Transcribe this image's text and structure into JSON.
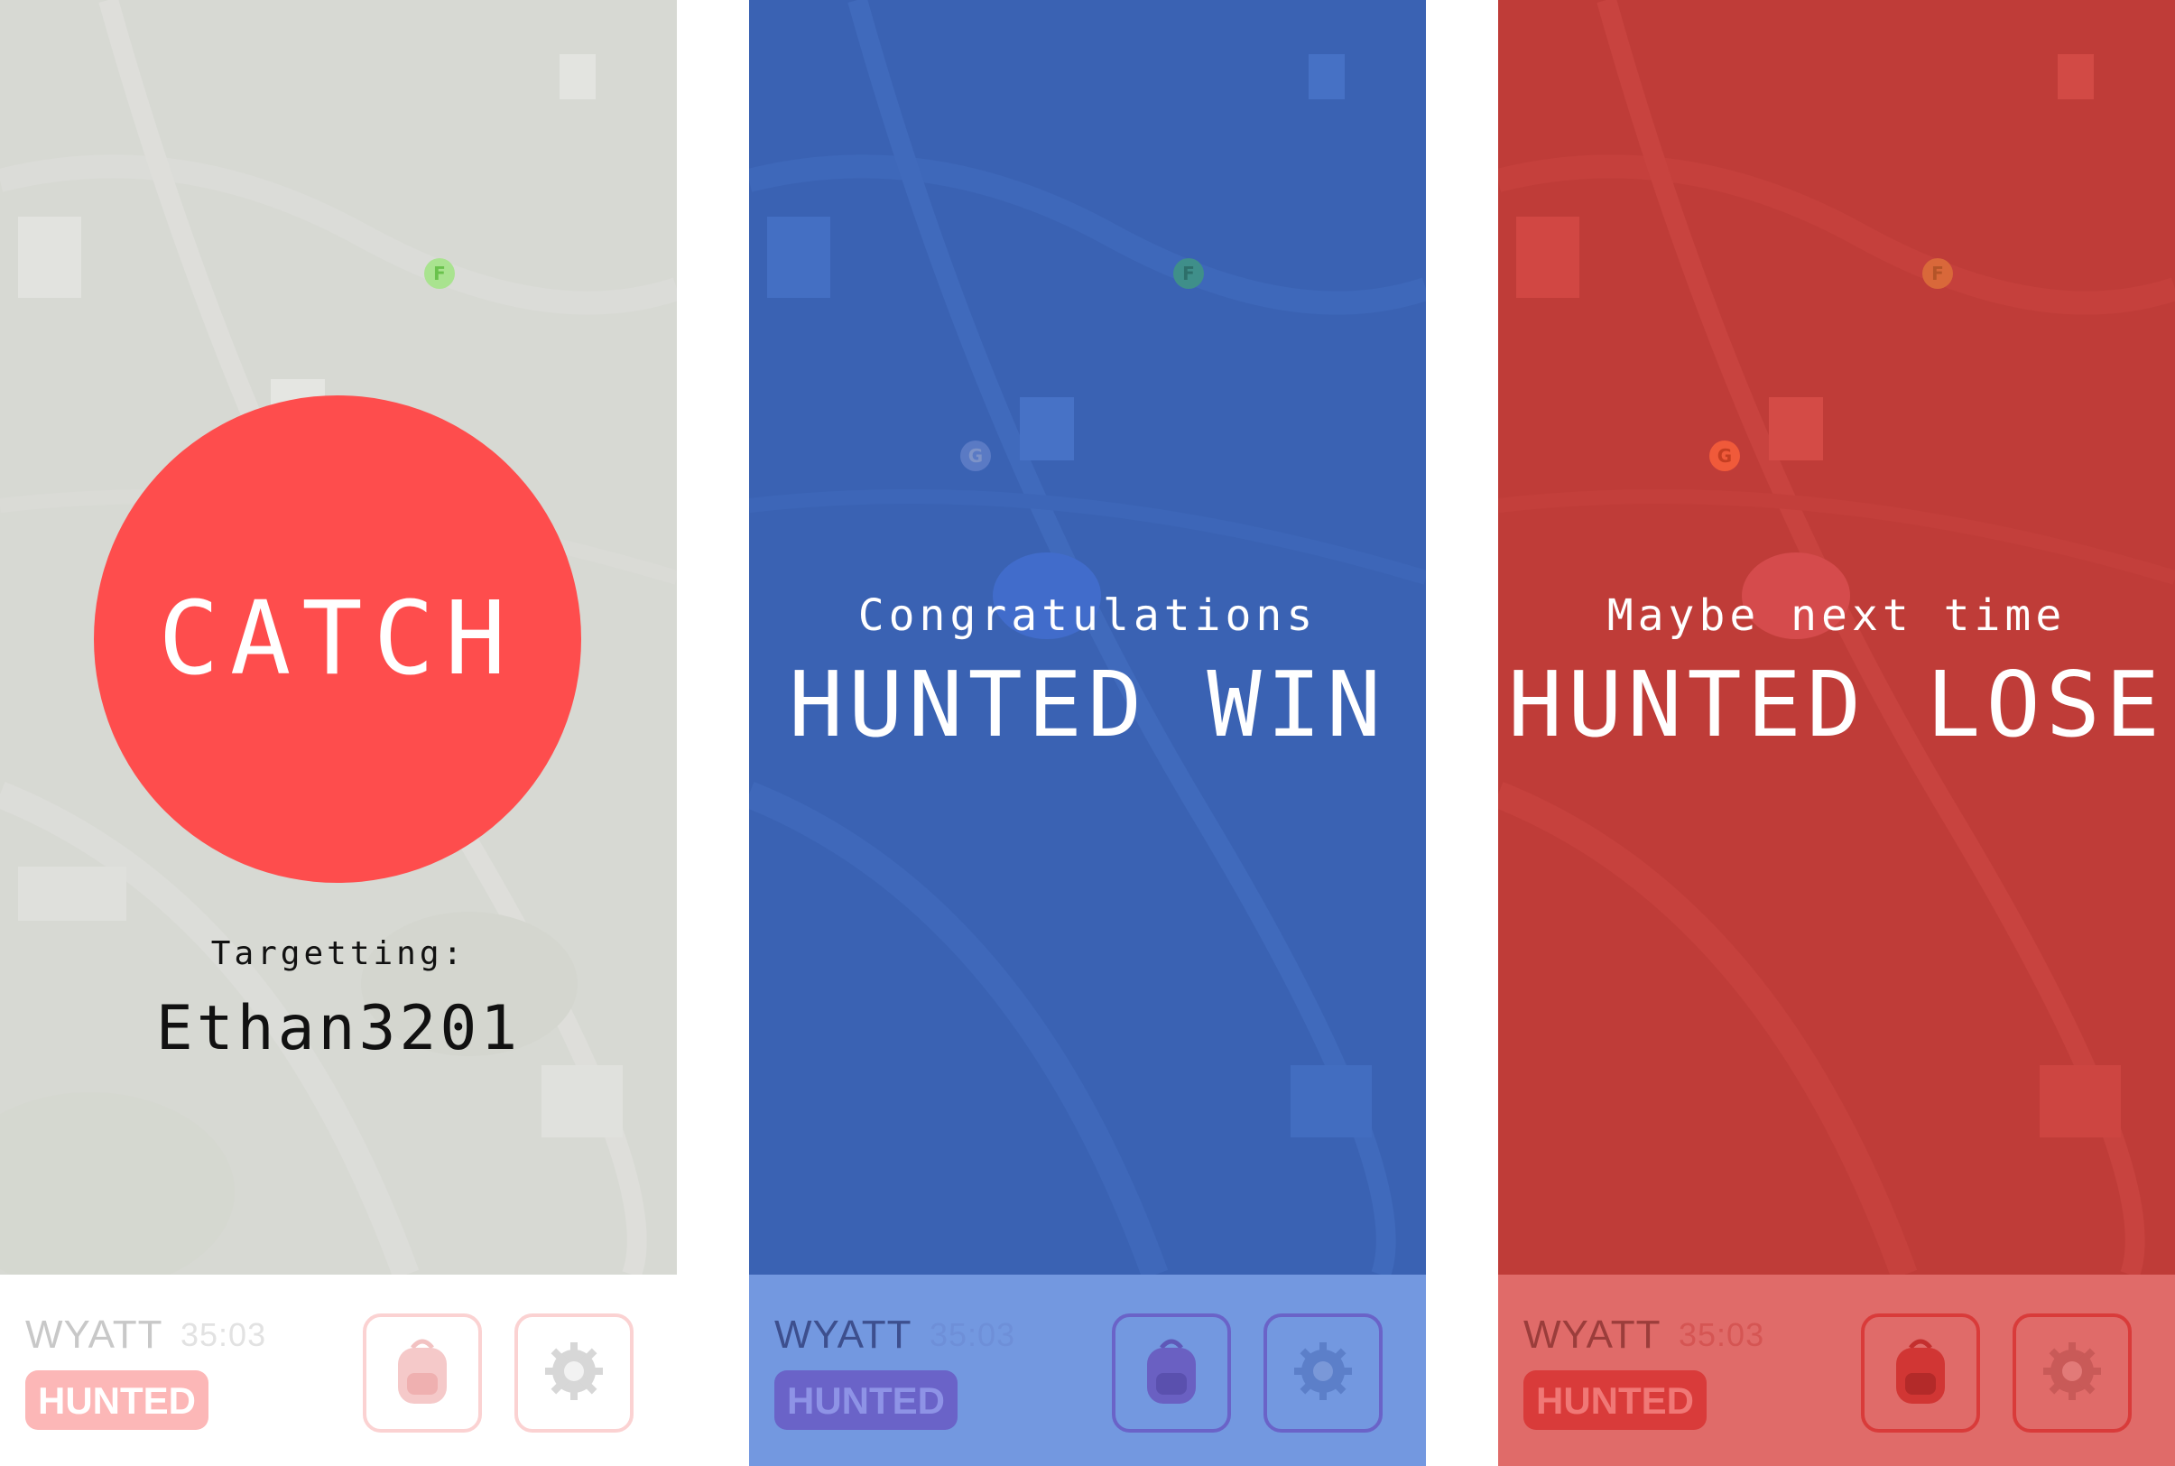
{
  "colors": {
    "catch_red": "#fe4d4d",
    "win_blue": "#3f6ec9",
    "lose_red": "#d8433f",
    "neutral_tint": "#e9eae7"
  },
  "map_markers": [
    "F",
    "G"
  ],
  "screens": [
    {
      "state": "active",
      "catch_label": "CATCH",
      "targetting_label": "Targetting:",
      "target_name": "Ethan3201",
      "player_name": "WYATT",
      "timer": "35:03",
      "role": "HUNTED",
      "icons": [
        "backpack-icon",
        "gear-icon"
      ]
    },
    {
      "state": "win",
      "message_small": "Congratulations",
      "message_big": "HUNTED WIN",
      "player_name": "WYATT",
      "timer": "35:03",
      "role": "HUNTED",
      "icons": [
        "backpack-icon",
        "gear-icon"
      ]
    },
    {
      "state": "lose",
      "message_small": "Maybe next time",
      "message_big": "HUNTED LOSE",
      "player_name": "WYATT",
      "timer": "35:03",
      "role": "HUNTED",
      "icons": [
        "backpack-icon",
        "gear-icon"
      ]
    }
  ]
}
